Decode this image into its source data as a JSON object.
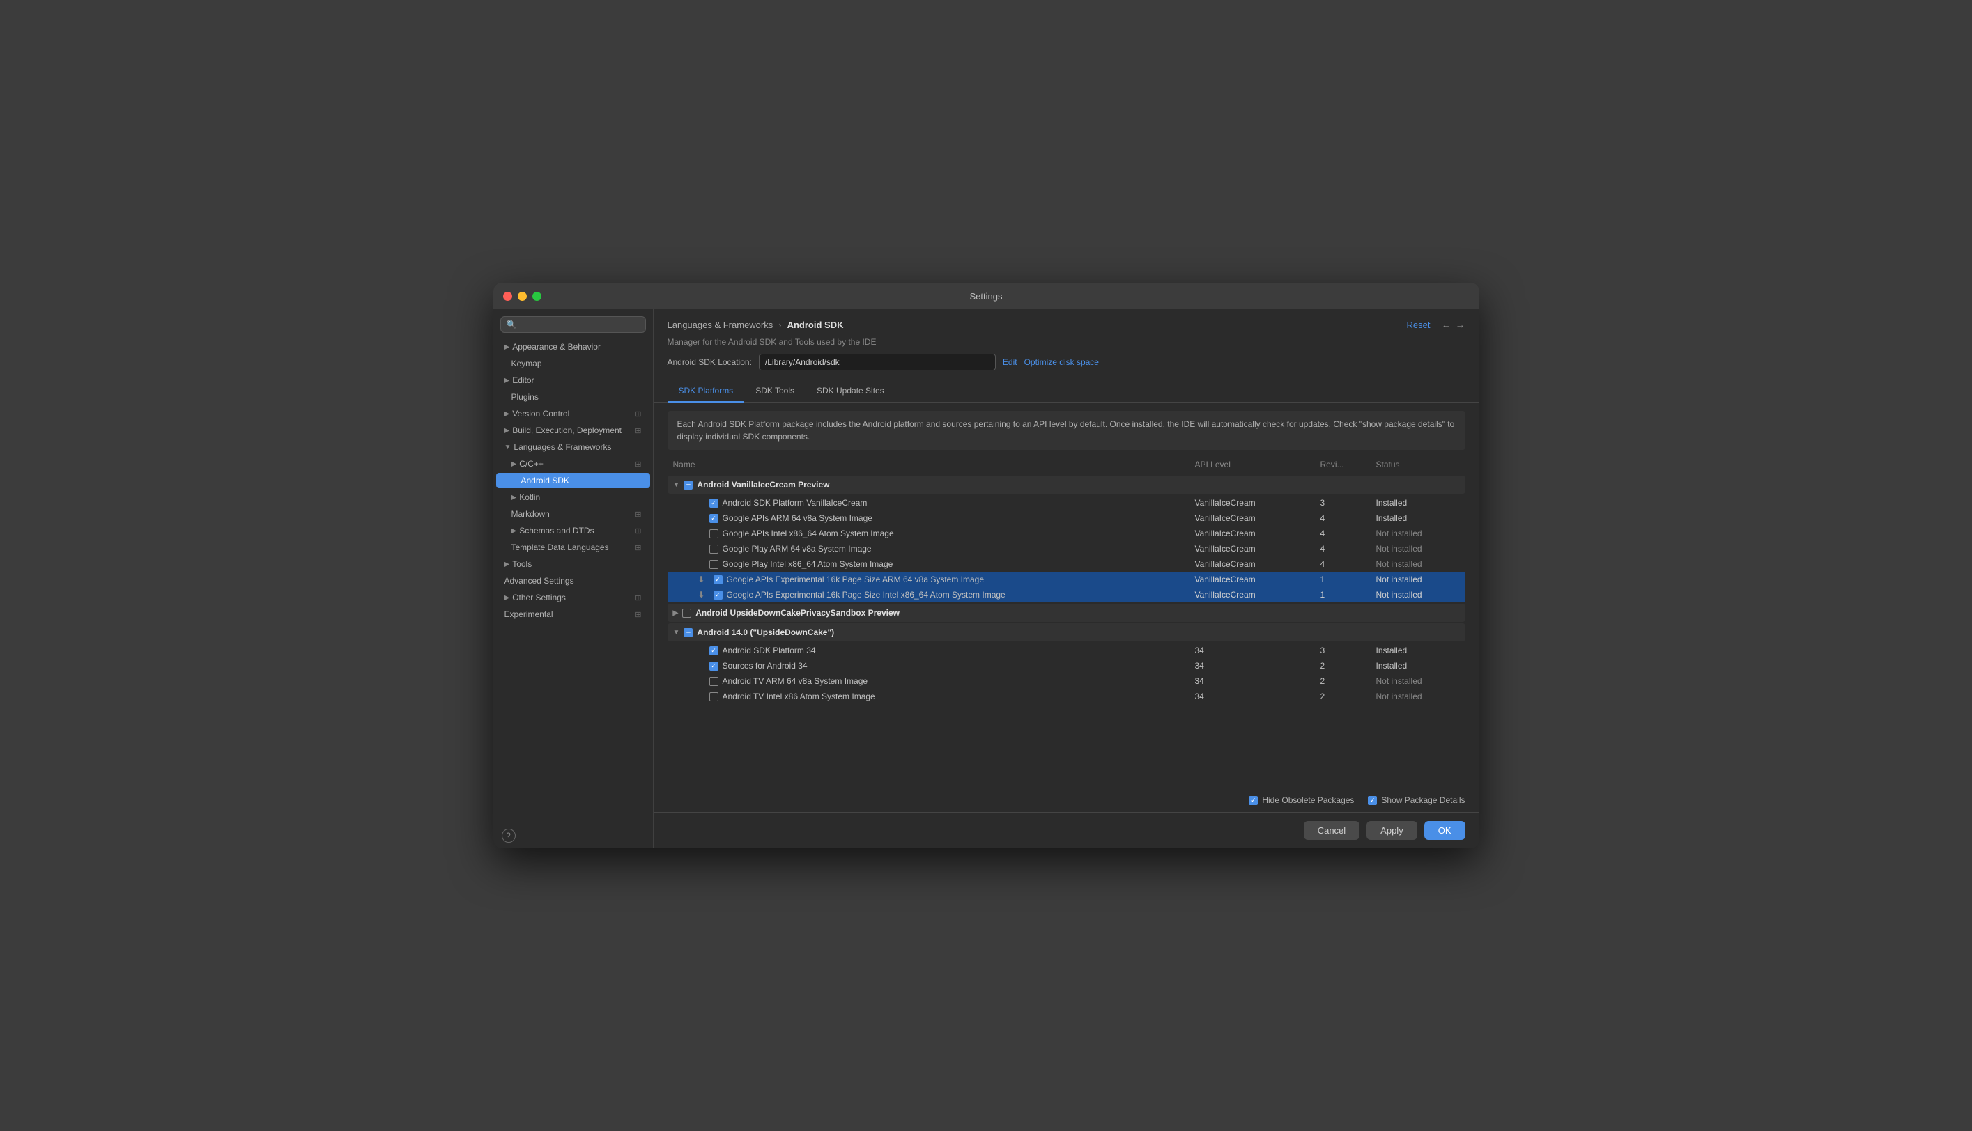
{
  "window": {
    "title": "Settings"
  },
  "sidebar": {
    "search_placeholder": "🔍",
    "items": [
      {
        "id": "appearance",
        "label": "Appearance & Behavior",
        "indent": 0,
        "expandable": true,
        "selected": false
      },
      {
        "id": "keymap",
        "label": "Keymap",
        "indent": 1,
        "expandable": false,
        "selected": false
      },
      {
        "id": "editor",
        "label": "Editor",
        "indent": 0,
        "expandable": true,
        "selected": false
      },
      {
        "id": "plugins",
        "label": "Plugins",
        "indent": 1,
        "expandable": false,
        "selected": false
      },
      {
        "id": "version-control",
        "label": "Version Control",
        "indent": 0,
        "expandable": true,
        "selected": false
      },
      {
        "id": "build-execution",
        "label": "Build, Execution, Deployment",
        "indent": 0,
        "expandable": true,
        "selected": false
      },
      {
        "id": "languages-frameworks",
        "label": "Languages & Frameworks",
        "indent": 0,
        "expandable": true,
        "expanded": true,
        "selected": false
      },
      {
        "id": "cpp",
        "label": "C/C++",
        "indent": 1,
        "expandable": true,
        "selected": false
      },
      {
        "id": "android-sdk",
        "label": "Android SDK",
        "indent": 2,
        "expandable": false,
        "selected": true
      },
      {
        "id": "kotlin",
        "label": "Kotlin",
        "indent": 1,
        "expandable": true,
        "selected": false
      },
      {
        "id": "markdown",
        "label": "Markdown",
        "indent": 1,
        "expandable": false,
        "selected": false
      },
      {
        "id": "schemas-dtds",
        "label": "Schemas and DTDs",
        "indent": 1,
        "expandable": true,
        "selected": false
      },
      {
        "id": "template-data",
        "label": "Template Data Languages",
        "indent": 1,
        "expandable": false,
        "selected": false
      },
      {
        "id": "tools",
        "label": "Tools",
        "indent": 0,
        "expandable": true,
        "selected": false
      },
      {
        "id": "advanced-settings",
        "label": "Advanced Settings",
        "indent": 0,
        "expandable": false,
        "selected": false
      },
      {
        "id": "other-settings",
        "label": "Other Settings",
        "indent": 0,
        "expandable": true,
        "selected": false
      },
      {
        "id": "experimental",
        "label": "Experimental",
        "indent": 0,
        "expandable": false,
        "selected": false
      }
    ]
  },
  "breadcrumb": {
    "parent": "Languages & Frameworks",
    "current": "Android SDK"
  },
  "header": {
    "reset_label": "Reset",
    "description": "Manager for the Android SDK and Tools used by the IDE",
    "sdk_location_label": "Android SDK Location:",
    "sdk_location_value": "/Library/Android/sdk",
    "edit_label": "Edit",
    "optimize_label": "Optimize disk space"
  },
  "tabs": [
    {
      "id": "sdk-platforms",
      "label": "SDK Platforms",
      "active": true
    },
    {
      "id": "sdk-tools",
      "label": "SDK Tools",
      "active": false
    },
    {
      "id": "sdk-update-sites",
      "label": "SDK Update Sites",
      "active": false
    }
  ],
  "info_text": "Each Android SDK Platform package includes the Android platform and sources pertaining to an API level by default. Once installed, the IDE will automatically check for updates. Check \"show package details\" to display individual SDK components.",
  "table": {
    "columns": [
      "Name",
      "API Level",
      "Revi...",
      "Status"
    ],
    "groups": [
      {
        "id": "vanilla-ice-cream",
        "name": "Android VanillaIceCream Preview",
        "expanded": true,
        "checkbox": "indeterminate",
        "rows": [
          {
            "name": "Android SDK Platform VanillaIceCream",
            "api": "VanillaIceCream",
            "rev": "3",
            "status": "Installed",
            "checked": true,
            "highlighted": false,
            "download": false
          },
          {
            "name": "Google APIs ARM 64 v8a System Image",
            "api": "VanillaIceCream",
            "rev": "4",
            "status": "Installed",
            "checked": true,
            "highlighted": false,
            "download": false
          },
          {
            "name": "Google APIs Intel x86_64 Atom System Image",
            "api": "VanillaIceCream",
            "rev": "4",
            "status": "Not installed",
            "checked": false,
            "highlighted": false,
            "download": false
          },
          {
            "name": "Google Play ARM 64 v8a System Image",
            "api": "VanillaIceCream",
            "rev": "4",
            "status": "Not installed",
            "checked": false,
            "highlighted": false,
            "download": false
          },
          {
            "name": "Google Play Intel x86_64 Atom System Image",
            "api": "VanillaIceCream",
            "rev": "4",
            "status": "Not installed",
            "checked": false,
            "highlighted": false,
            "download": false
          },
          {
            "name": "Google APIs Experimental 16k Page Size ARM 64 v8a System Image",
            "api": "VanillaIceCream",
            "rev": "1",
            "status": "Not installed",
            "checked": true,
            "highlighted": true,
            "download": true
          },
          {
            "name": "Google APIs Experimental 16k Page Size Intel x86_64 Atom System Image",
            "api": "VanillaIceCream",
            "rev": "1",
            "status": "Not installed",
            "checked": true,
            "highlighted": true,
            "download": true
          }
        ]
      },
      {
        "id": "upside-down-cake-sandbox",
        "name": "Android UpsideDownCakePrivacySandbox Preview",
        "expanded": false,
        "checkbox": "unchecked",
        "rows": []
      },
      {
        "id": "android-14",
        "name": "Android 14.0 (\"UpsideDownCake\")",
        "expanded": true,
        "checkbox": "indeterminate",
        "rows": [
          {
            "name": "Android SDK Platform 34",
            "api": "34",
            "rev": "3",
            "status": "Installed",
            "checked": true,
            "highlighted": false,
            "download": false
          },
          {
            "name": "Sources for Android 34",
            "api": "34",
            "rev": "2",
            "status": "Installed",
            "checked": true,
            "highlighted": false,
            "download": false
          },
          {
            "name": "Android TV ARM 64 v8a System Image",
            "api": "34",
            "rev": "2",
            "status": "Not installed",
            "checked": false,
            "highlighted": false,
            "download": false
          },
          {
            "name": "Android TV Intel x86 Atom System Image",
            "api": "34",
            "rev": "2",
            "status": "Not installed",
            "checked": false,
            "highlighted": false,
            "download": false
          }
        ]
      }
    ]
  },
  "footer": {
    "hide_obsolete": {
      "label": "Hide Obsolete Packages",
      "checked": true
    },
    "show_package_details": {
      "label": "Show Package Details",
      "checked": true
    }
  },
  "dialog_footer": {
    "cancel_label": "Cancel",
    "apply_label": "Apply",
    "ok_label": "OK"
  }
}
